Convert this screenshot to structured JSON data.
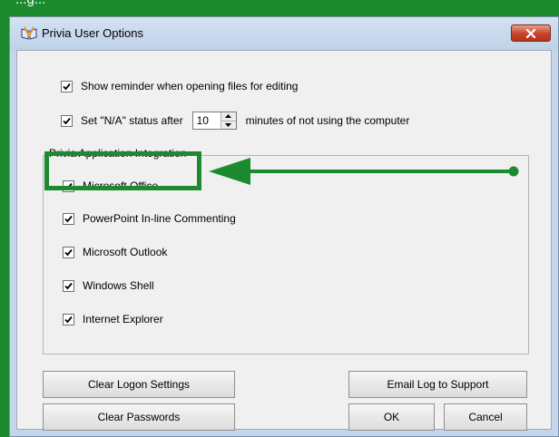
{
  "top_banner": {
    "text": "...g..."
  },
  "window": {
    "title": "Privia User Options",
    "icon": "privia-app-icon",
    "close_icon": "close-x-icon"
  },
  "options": {
    "show_reminder": {
      "label": "Show reminder when opening files for editing",
      "checked": true
    },
    "na_status": {
      "prefix": "Set \"N/A\" status after",
      "value": "10",
      "suffix": "minutes of not using the computer",
      "checked": true
    }
  },
  "integration": {
    "legend": "Privia Application Integration",
    "items": [
      {
        "label": "Microsoft Office",
        "checked": true
      },
      {
        "label": "PowerPoint In-line Commenting",
        "checked": true
      },
      {
        "label": "Microsoft Outlook",
        "checked": true
      },
      {
        "label": "Windows Shell",
        "checked": true
      },
      {
        "label": "Internet Explorer",
        "checked": true
      }
    ]
  },
  "buttons": {
    "clear_logon": "Clear Logon Settings",
    "email_log": "Email Log to Support",
    "clear_passwords": "Clear Passwords",
    "ok": "OK",
    "cancel": "Cancel"
  },
  "annotation": {
    "color": "#1c8a2f",
    "target": "Microsoft Office"
  }
}
